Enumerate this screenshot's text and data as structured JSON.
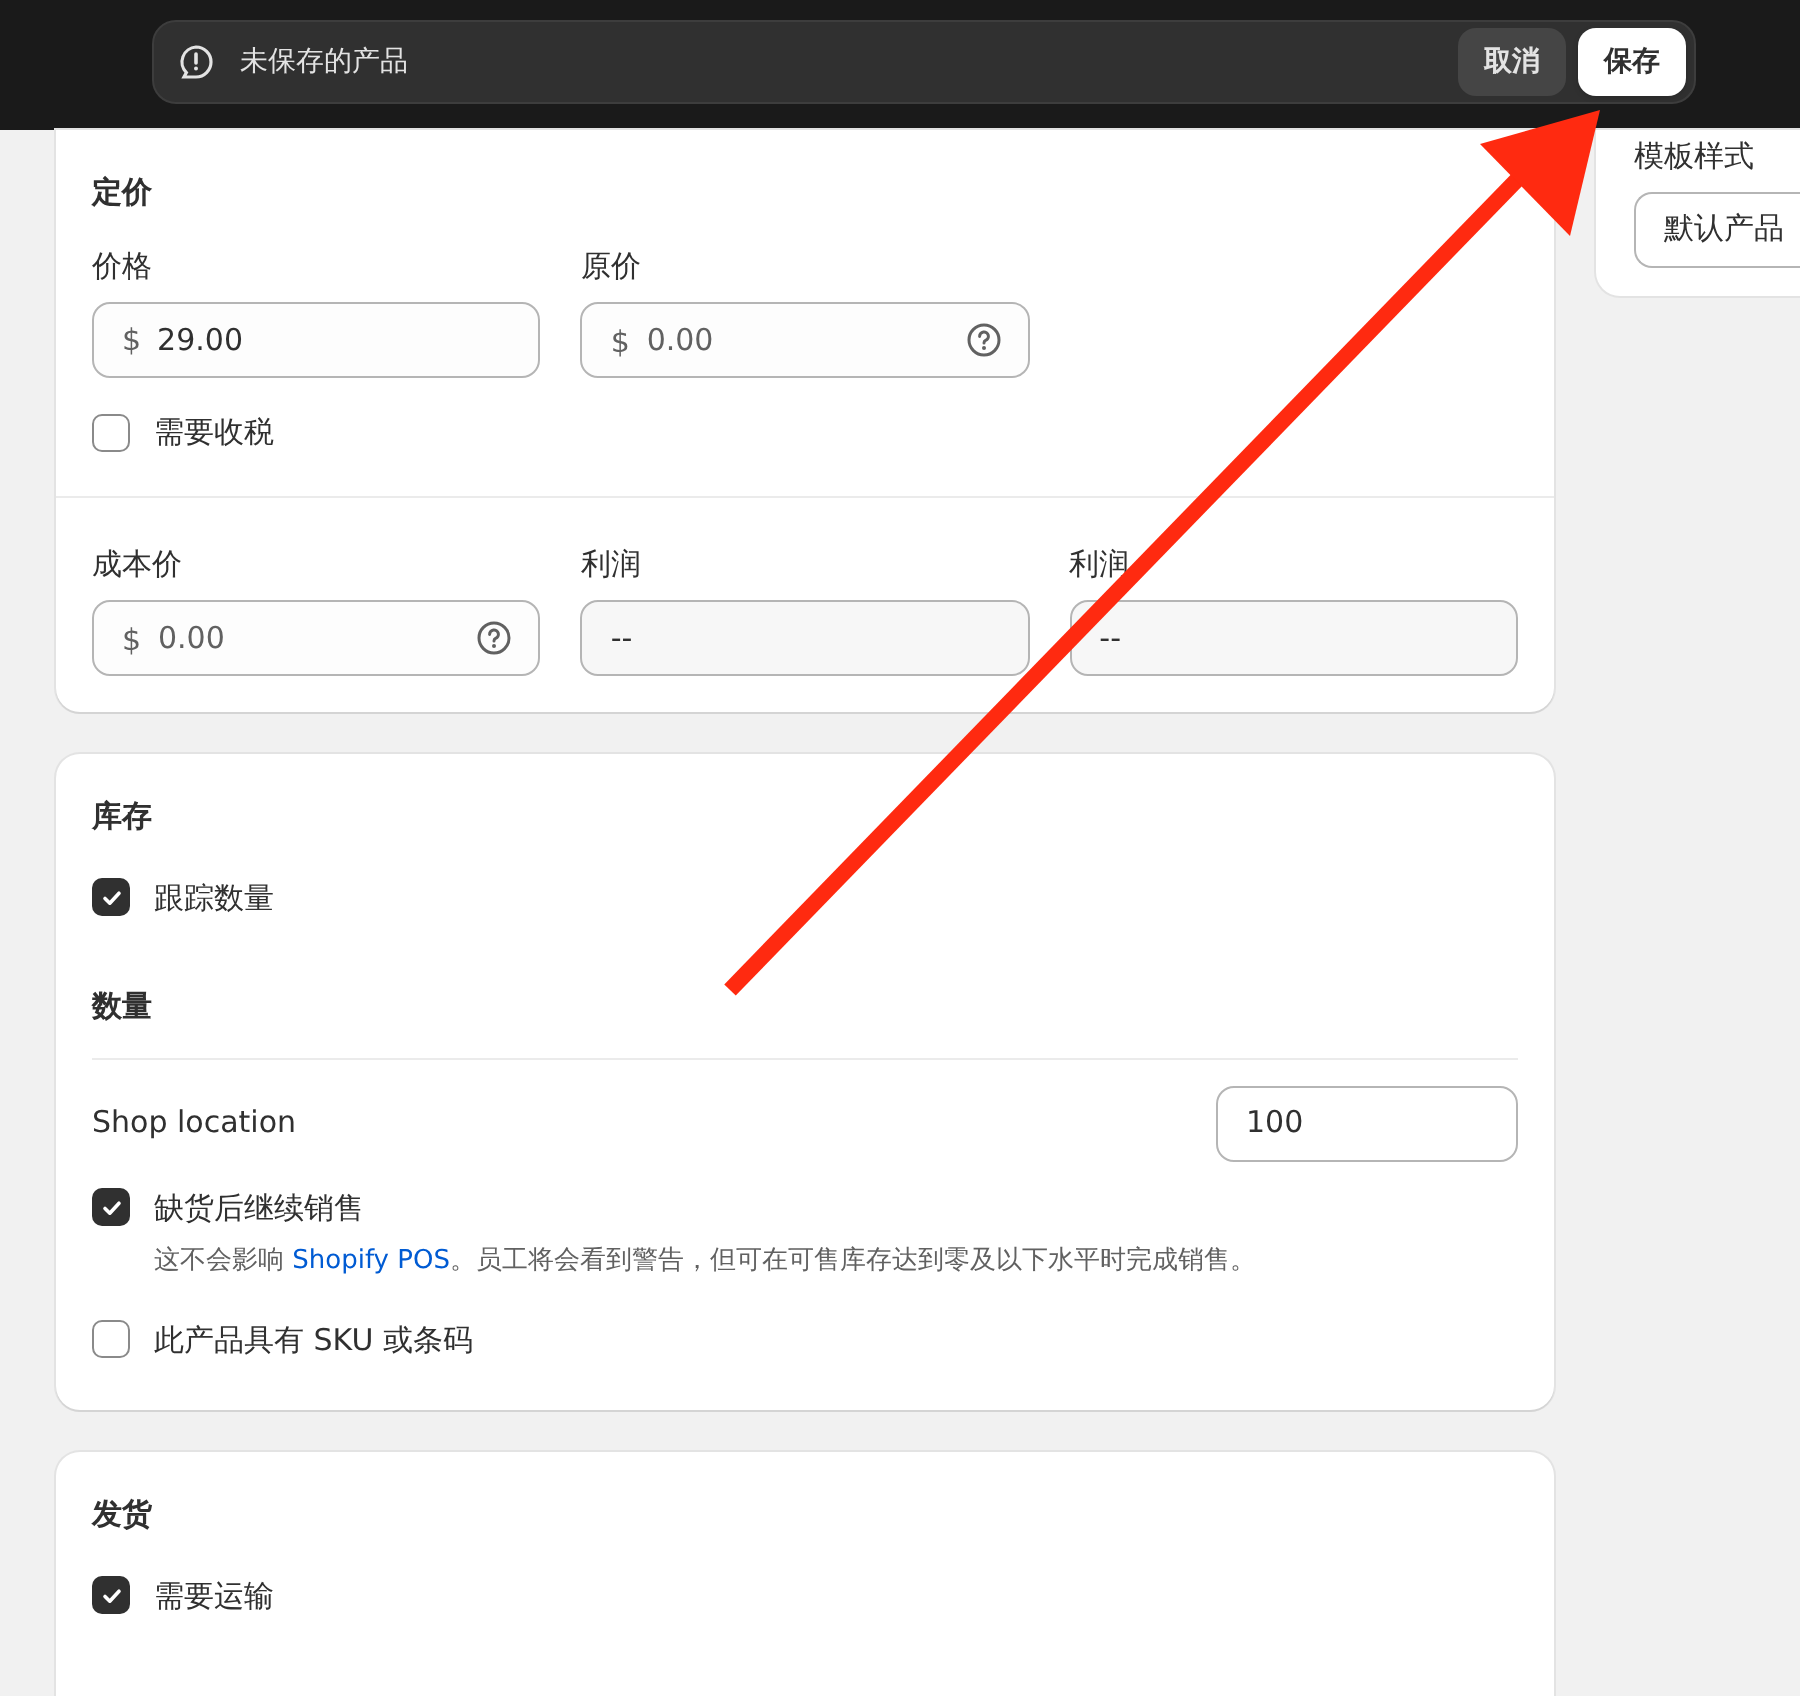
{
  "save_bar": {
    "message": "未保存的产品",
    "buttons": [
      {
        "label": "取消",
        "kind": "secondary"
      },
      {
        "label": "保存",
        "kind": "primary"
      }
    ]
  },
  "pricing": {
    "title": "定价",
    "price": {
      "label": "价格",
      "prefix": "$",
      "value": "29.00"
    },
    "compare_price": {
      "label": "原价",
      "prefix": "$",
      "placeholder": "0.00"
    },
    "charge_tax": {
      "label": "需要收税",
      "checked": false
    },
    "cost": {
      "label": "成本价",
      "prefix": "$",
      "placeholder": "0.00"
    },
    "profit": {
      "label": "利润",
      "value": "--"
    },
    "margin": {
      "label": "利润",
      "value": "--"
    }
  },
  "inventory": {
    "title": "库存",
    "track": {
      "label": "跟踪数量",
      "checked": true
    },
    "quantity_title": "数量",
    "location": {
      "label": "Shop location",
      "value": "100"
    },
    "continue_selling": {
      "label": "缺货后继续销售",
      "checked": true,
      "help_before": "这不会影响 ",
      "help_link": "Shopify POS",
      "help_after": "。员工将会看到警告，但可在可售库存达到零及以下水平时完成销售。"
    },
    "has_sku": {
      "label": "此产品具有 SKU 或条码",
      "checked": false
    }
  },
  "shipping": {
    "title": "发货",
    "requires_shipping": {
      "label": "需要运输",
      "checked": true
    }
  },
  "side": {
    "template_label": "模板样式",
    "template_value": "默认产品"
  }
}
